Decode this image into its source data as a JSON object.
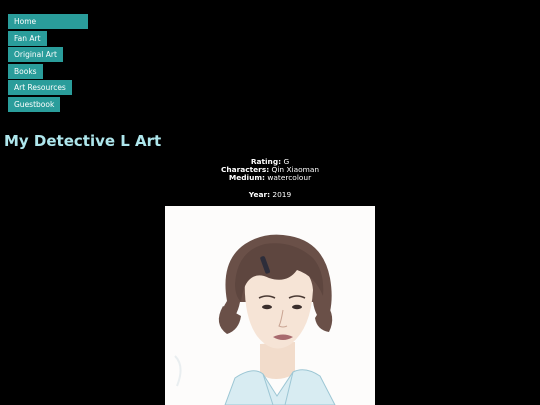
{
  "nav": {
    "items": [
      {
        "label": "Home"
      },
      {
        "label": "Fan Art"
      },
      {
        "label": "Original Art"
      },
      {
        "label": "Books"
      },
      {
        "label": "Art Resources"
      },
      {
        "label": "Guestbook"
      }
    ]
  },
  "page": {
    "title": "My Detective L Art"
  },
  "details": {
    "rating_label": "Rating:",
    "rating_value": "G",
    "characters_label": "Characters:",
    "characters_value": "Qin Xiaoman",
    "medium_label": "Medium:",
    "medium_value": "watercolour",
    "year_label": "Year:",
    "year_value": "2019"
  },
  "colors": {
    "background": "#000000",
    "nav_bg": "#2a9d9b",
    "title": "#aee6ec"
  }
}
